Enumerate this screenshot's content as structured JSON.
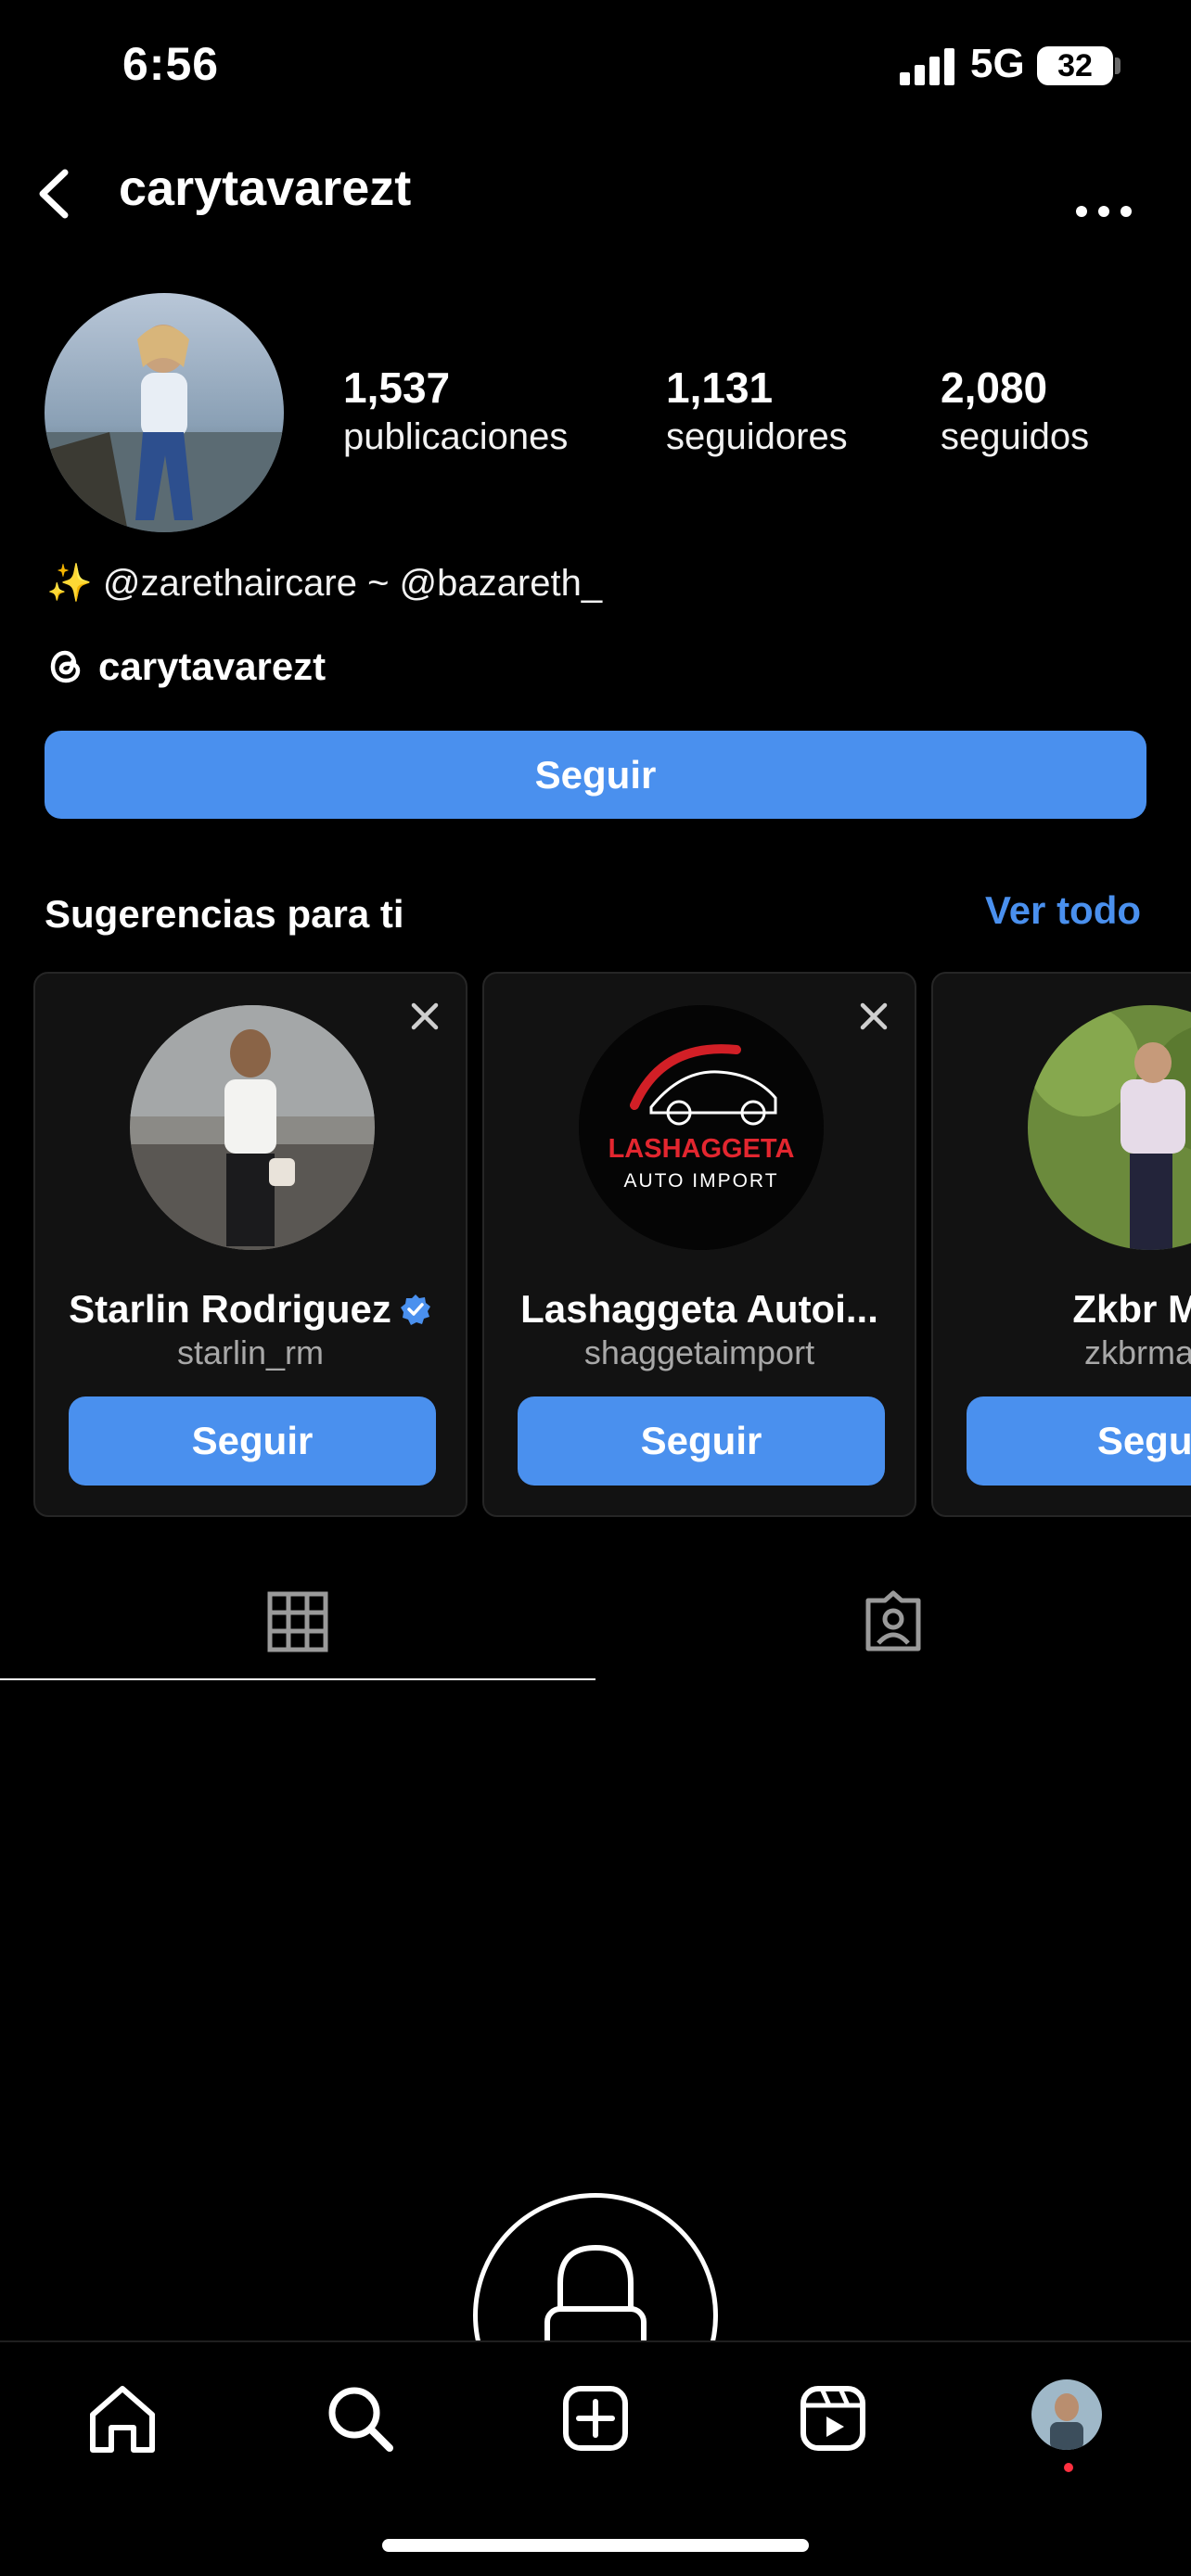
{
  "status_bar": {
    "time": "6:56",
    "network": "5G",
    "battery": "32",
    "battery_level_percent": 32
  },
  "header": {
    "username": "carytavarezt"
  },
  "profile": {
    "stats": [
      {
        "value": "1,537",
        "label": "publicaciones"
      },
      {
        "value": "1,131",
        "label": "seguidores"
      },
      {
        "value": "2,080",
        "label": "seguidos"
      }
    ],
    "bio": "✨ @zarethaircare ~ @bazareth_",
    "threads_handle": "carytavarezt",
    "follow_label": "Seguir"
  },
  "suggestions": {
    "title": "Sugerencias para ti",
    "see_all": "Ver todo",
    "cards": [
      {
        "name": "Starlin Rodriguez",
        "handle": "starlin_rm",
        "verified": true,
        "follow_label": "Seguir"
      },
      {
        "name": "Lashaggeta Autoi...",
        "handle": "shaggetaimport",
        "verified": false,
        "follow_label": "Seguir",
        "logo_line1": "LASHAGGETA",
        "logo_line2": "AUTO IMPORT"
      },
      {
        "name": "Zkbr Mo",
        "handle": "zkbrmari",
        "verified": false,
        "follow_label": "Segui"
      }
    ]
  },
  "tabs": [
    {
      "icon": "grid-icon",
      "active": true
    },
    {
      "icon": "tagged-icon",
      "active": false
    }
  ],
  "bottom_nav": [
    {
      "icon": "home-icon"
    },
    {
      "icon": "search-icon"
    },
    {
      "icon": "create-icon"
    },
    {
      "icon": "reels-icon"
    },
    {
      "icon": "profile-avatar"
    }
  ],
  "colors": {
    "accent": "#4a90ee",
    "background": "#000000",
    "card": "#121212",
    "notification": "#ff3040"
  }
}
